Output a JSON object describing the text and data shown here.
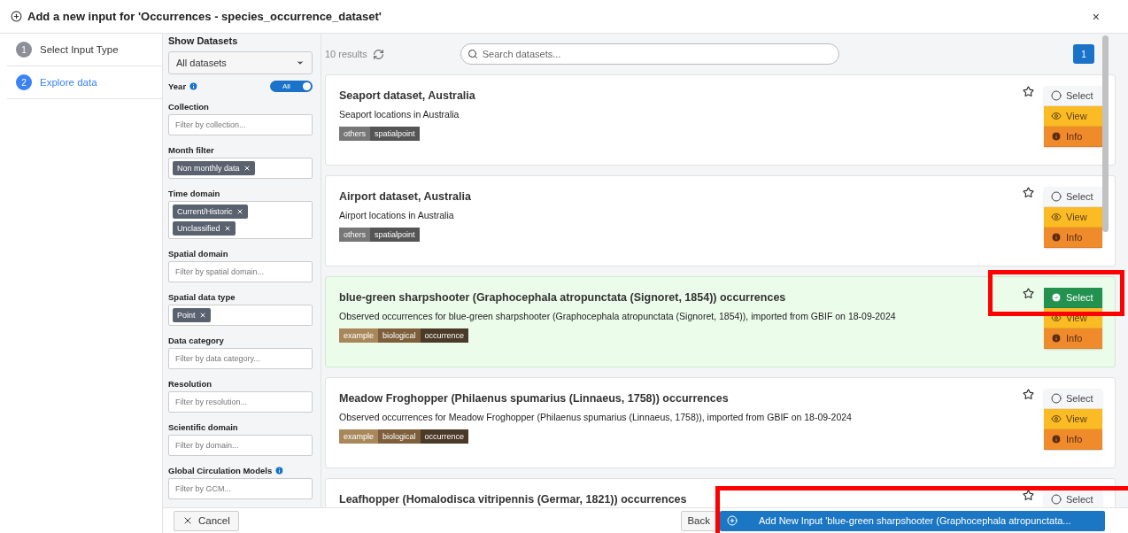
{
  "window": {
    "title": "Add a new input for 'Occurrences - species_occurrence_dataset'",
    "close": "×"
  },
  "steps": [
    {
      "number": "1",
      "label": "Select Input Type",
      "selected": false
    },
    {
      "number": "2",
      "label": "Explore data",
      "selected": true
    }
  ],
  "filters": [
    {
      "kind": "select",
      "label": "Show Datasets",
      "value": "All datasets"
    },
    {
      "kind": "toggle",
      "label": "Year",
      "info": true,
      "on": true,
      "value": "All"
    },
    {
      "kind": "text",
      "label": "Collection",
      "placeholder": "Filter by collection..."
    },
    {
      "kind": "chips",
      "label": "Month filter",
      "chips": [
        "Non monthly data"
      ]
    },
    {
      "kind": "chips",
      "label": "Time domain",
      "chips": [
        "Current/Historic",
        "Unclassified"
      ]
    },
    {
      "kind": "text",
      "label": "Spatial domain",
      "placeholder": "Filter by spatial domain..."
    },
    {
      "kind": "chips",
      "label": "Spatial data type",
      "chips": [
        "Point"
      ]
    },
    {
      "kind": "text",
      "label": "Data category",
      "placeholder": "Filter by data category..."
    },
    {
      "kind": "text",
      "label": "Resolution",
      "placeholder": "Filter by resolution..."
    },
    {
      "kind": "text",
      "label": "Scientific domain",
      "placeholder": "Filter by domain..."
    },
    {
      "kind": "text",
      "label": "Global Circulation Models",
      "info": true,
      "placeholder": "Filter by GCM..."
    }
  ],
  "results": {
    "count": "10 results",
    "search_placeholder": "Search datasets...",
    "pages": [
      {
        "label": "1",
        "selected": true
      }
    ]
  },
  "datasets": [
    {
      "title": "Seaport dataset, Australia",
      "description": "Seaport locations in Australia",
      "selected": false,
      "tags": [
        {
          "label": "others",
          "color": "#777777"
        },
        {
          "label": "spatialpoint",
          "color": "#555555"
        }
      ],
      "actions": [
        {
          "kind": "select",
          "label": "Select",
          "selected": false,
          "highlighted": false
        },
        {
          "kind": "view",
          "label": "View"
        },
        {
          "kind": "info",
          "label": "Info"
        }
      ]
    },
    {
      "title": "Airport dataset, Australia",
      "description": "Airport locations in Australia",
      "selected": false,
      "tags": [
        {
          "label": "others",
          "color": "#777777"
        },
        {
          "label": "spatialpoint",
          "color": "#555555"
        }
      ],
      "actions": [
        {
          "kind": "select",
          "label": "Select",
          "selected": false,
          "highlighted": false
        },
        {
          "kind": "view",
          "label": "View"
        },
        {
          "kind": "info",
          "label": "Info"
        }
      ]
    },
    {
      "title": "blue-green sharpshooter (Graphocephala atropunctata (Signoret, 1854)) occurrences",
      "description": "Observed occurrences for blue-green sharpshooter (Graphocephala atropunctata (Signoret, 1854)), imported from GBIF on 18-09-2024",
      "selected": true,
      "tags": [
        {
          "label": "example",
          "color": "#a8875a"
        },
        {
          "label": "biological",
          "color": "#7e5f3c"
        },
        {
          "label": "occurrence",
          "color": "#4b3a27"
        }
      ],
      "actions": [
        {
          "kind": "select",
          "label": "Select",
          "selected": true,
          "highlighted": true
        },
        {
          "kind": "view",
          "label": "View"
        },
        {
          "kind": "info",
          "label": "Info"
        }
      ]
    },
    {
      "title": "Meadow Froghopper (Philaenus spumarius (Linnaeus, 1758)) occurrences",
      "description": "Observed occurrences for Meadow Froghopper (Philaenus spumarius (Linnaeus, 1758)), imported from GBIF on 18-09-2024",
      "selected": false,
      "tags": [
        {
          "label": "example",
          "color": "#a8875a"
        },
        {
          "label": "biological",
          "color": "#7e5f3c"
        },
        {
          "label": "occurrence",
          "color": "#4b3a27"
        }
      ],
      "actions": [
        {
          "kind": "select",
          "label": "Select",
          "selected": false,
          "highlighted": false
        },
        {
          "kind": "view",
          "label": "View"
        },
        {
          "kind": "info",
          "label": "Info"
        }
      ]
    },
    {
      "title": "Leafhopper (Homalodisca vitripennis (Germar, 1821)) occurrences",
      "selected": false,
      "actions": [
        {
          "kind": "select",
          "label": "Select",
          "selected": false,
          "highlighted": false
        }
      ]
    }
  ],
  "footer": {
    "cancel": "Cancel",
    "back": "Back",
    "add": {
      "label": "Add New Input 'blue-green sharpshooter (Graphocephala atropunctata...",
      "highlighted": true
    }
  }
}
